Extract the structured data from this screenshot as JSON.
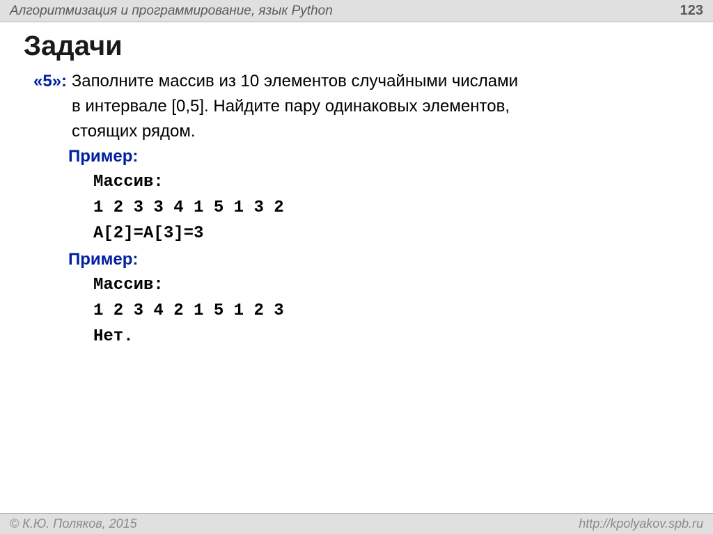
{
  "header": {
    "title": "Алгоритмизация и программирование, язык Python",
    "page_number": "123"
  },
  "slide": {
    "title": "Задачи"
  },
  "task": {
    "grade": "«5»:",
    "line1": "Заполните массив из 10 элементов случайными числами",
    "line2": "в интервале [0,5]. Найдите пару одинаковых элементов,",
    "line3": "стоящих рядом."
  },
  "example1": {
    "label": "Пример:",
    "l1": "Массив:",
    "l2": "1 2 3 3 4 1 5 1 3 2",
    "l3": "A[2]=A[3]=3"
  },
  "example2": {
    "label": "Пример:",
    "l1": "Массив:",
    "l2": "1 2 3 4 2 1 5 1 2 3",
    "l3": "Нет."
  },
  "footer": {
    "left": "© К.Ю. Поляков, 2015",
    "right": "http://kpolyakov.spb.ru"
  }
}
